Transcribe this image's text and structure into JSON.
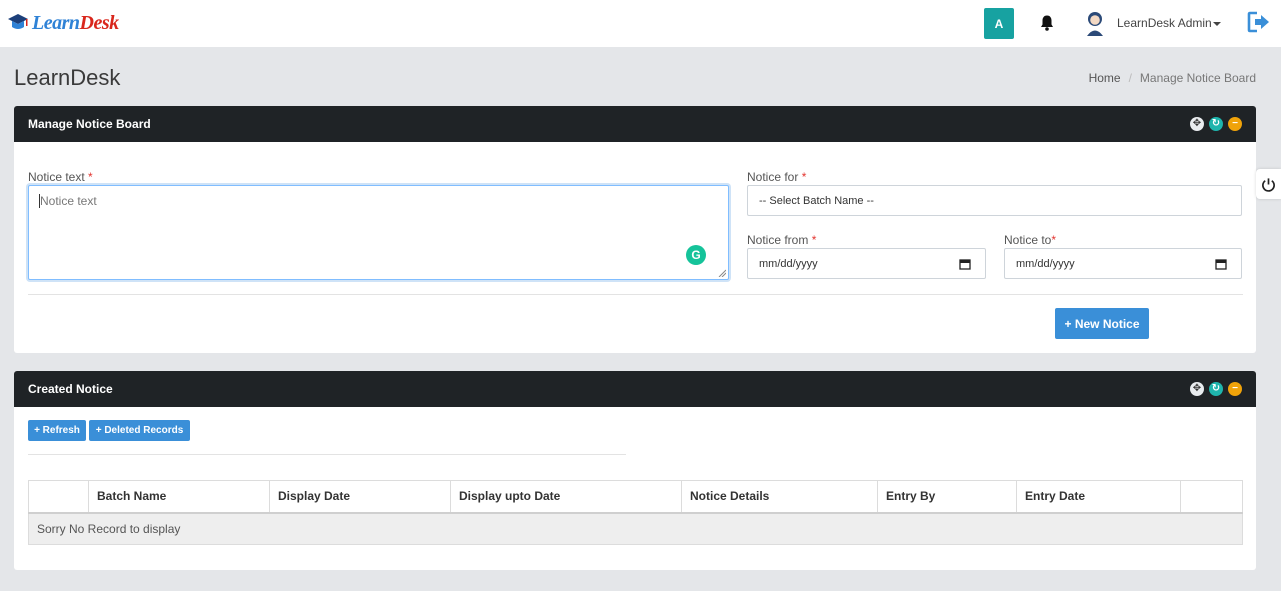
{
  "brand": {
    "part1": "Learn",
    "part2": "Desk"
  },
  "topbar": {
    "avatar_letter": "A",
    "user_name": "LearnDesk Admin"
  },
  "page": {
    "title": "LearnDesk",
    "breadcrumb": {
      "home": "Home",
      "current": "Manage Notice Board"
    }
  },
  "manage_panel": {
    "title": "Manage Notice Board",
    "notice_text": {
      "label": "Notice text",
      "required": "*",
      "placeholder": "Notice text"
    },
    "notice_for": {
      "label": "Notice for",
      "required": "*",
      "value": "-- Select Batch Name --"
    },
    "notice_from": {
      "label": "Notice from",
      "required": "*",
      "value": "mm/dd/yyyy"
    },
    "notice_to": {
      "label": "Notice to",
      "required": "*",
      "value": "mm/dd/yyyy"
    },
    "new_notice_label": "+ New Notice"
  },
  "created_panel": {
    "title": "Created Notice",
    "refresh_label": "+ Refresh",
    "deleted_label": "+ Deleted Records",
    "columns": [
      "",
      "Batch Name",
      "Display Date",
      "Display upto Date",
      "Notice Details",
      "Entry By",
      "Entry Date",
      ""
    ],
    "empty_message": "Sorry No Record to display"
  },
  "colors": {
    "header_bg": "#1f2326",
    "primary": "#3a8fd8",
    "avatar": "#17a2a1",
    "reload": "#1fb5ad",
    "collapse": "#f0a30a",
    "required": "#e3342f"
  }
}
